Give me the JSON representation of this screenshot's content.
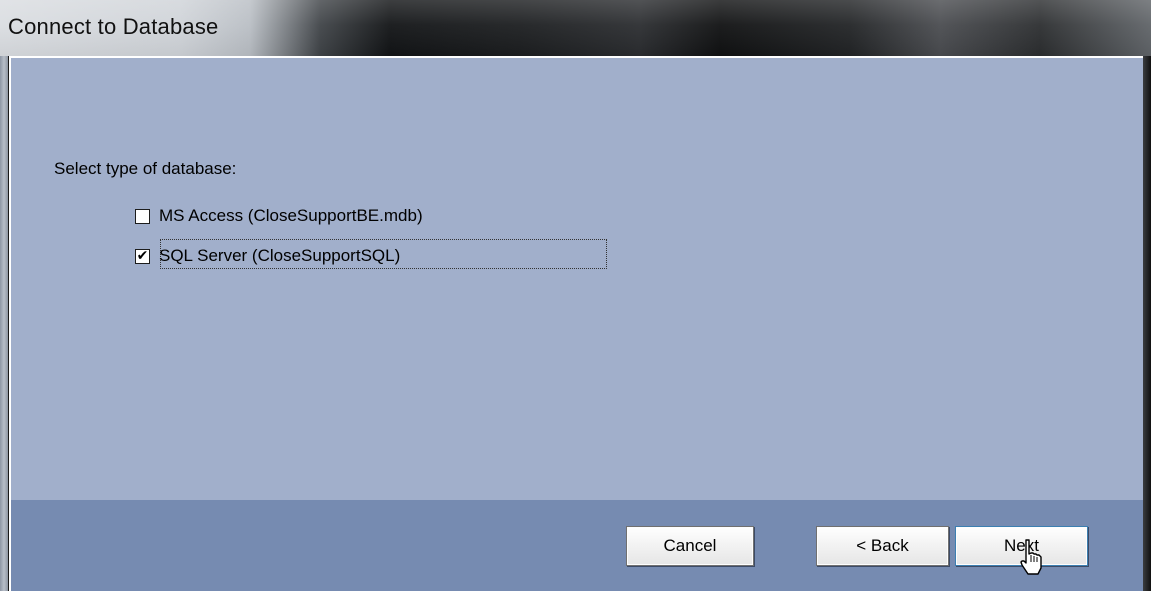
{
  "window": {
    "title": "Connect to Database"
  },
  "main": {
    "prompt": "Select type of database:",
    "options": [
      {
        "label": "MS Access (CloseSupportBE.mdb)",
        "checked": false
      },
      {
        "label": "SQL Server (CloseSupportSQL)",
        "checked": true
      }
    ]
  },
  "footer": {
    "cancel_label": "Cancel",
    "back_label": "< Back",
    "next_label": "Next"
  },
  "icons": {
    "cursor": "hand-pointer-cursor-icon",
    "check": "checkmark-icon"
  },
  "colors": {
    "content_bg": "#a1afcb",
    "footer_bg": "#768bb1"
  }
}
